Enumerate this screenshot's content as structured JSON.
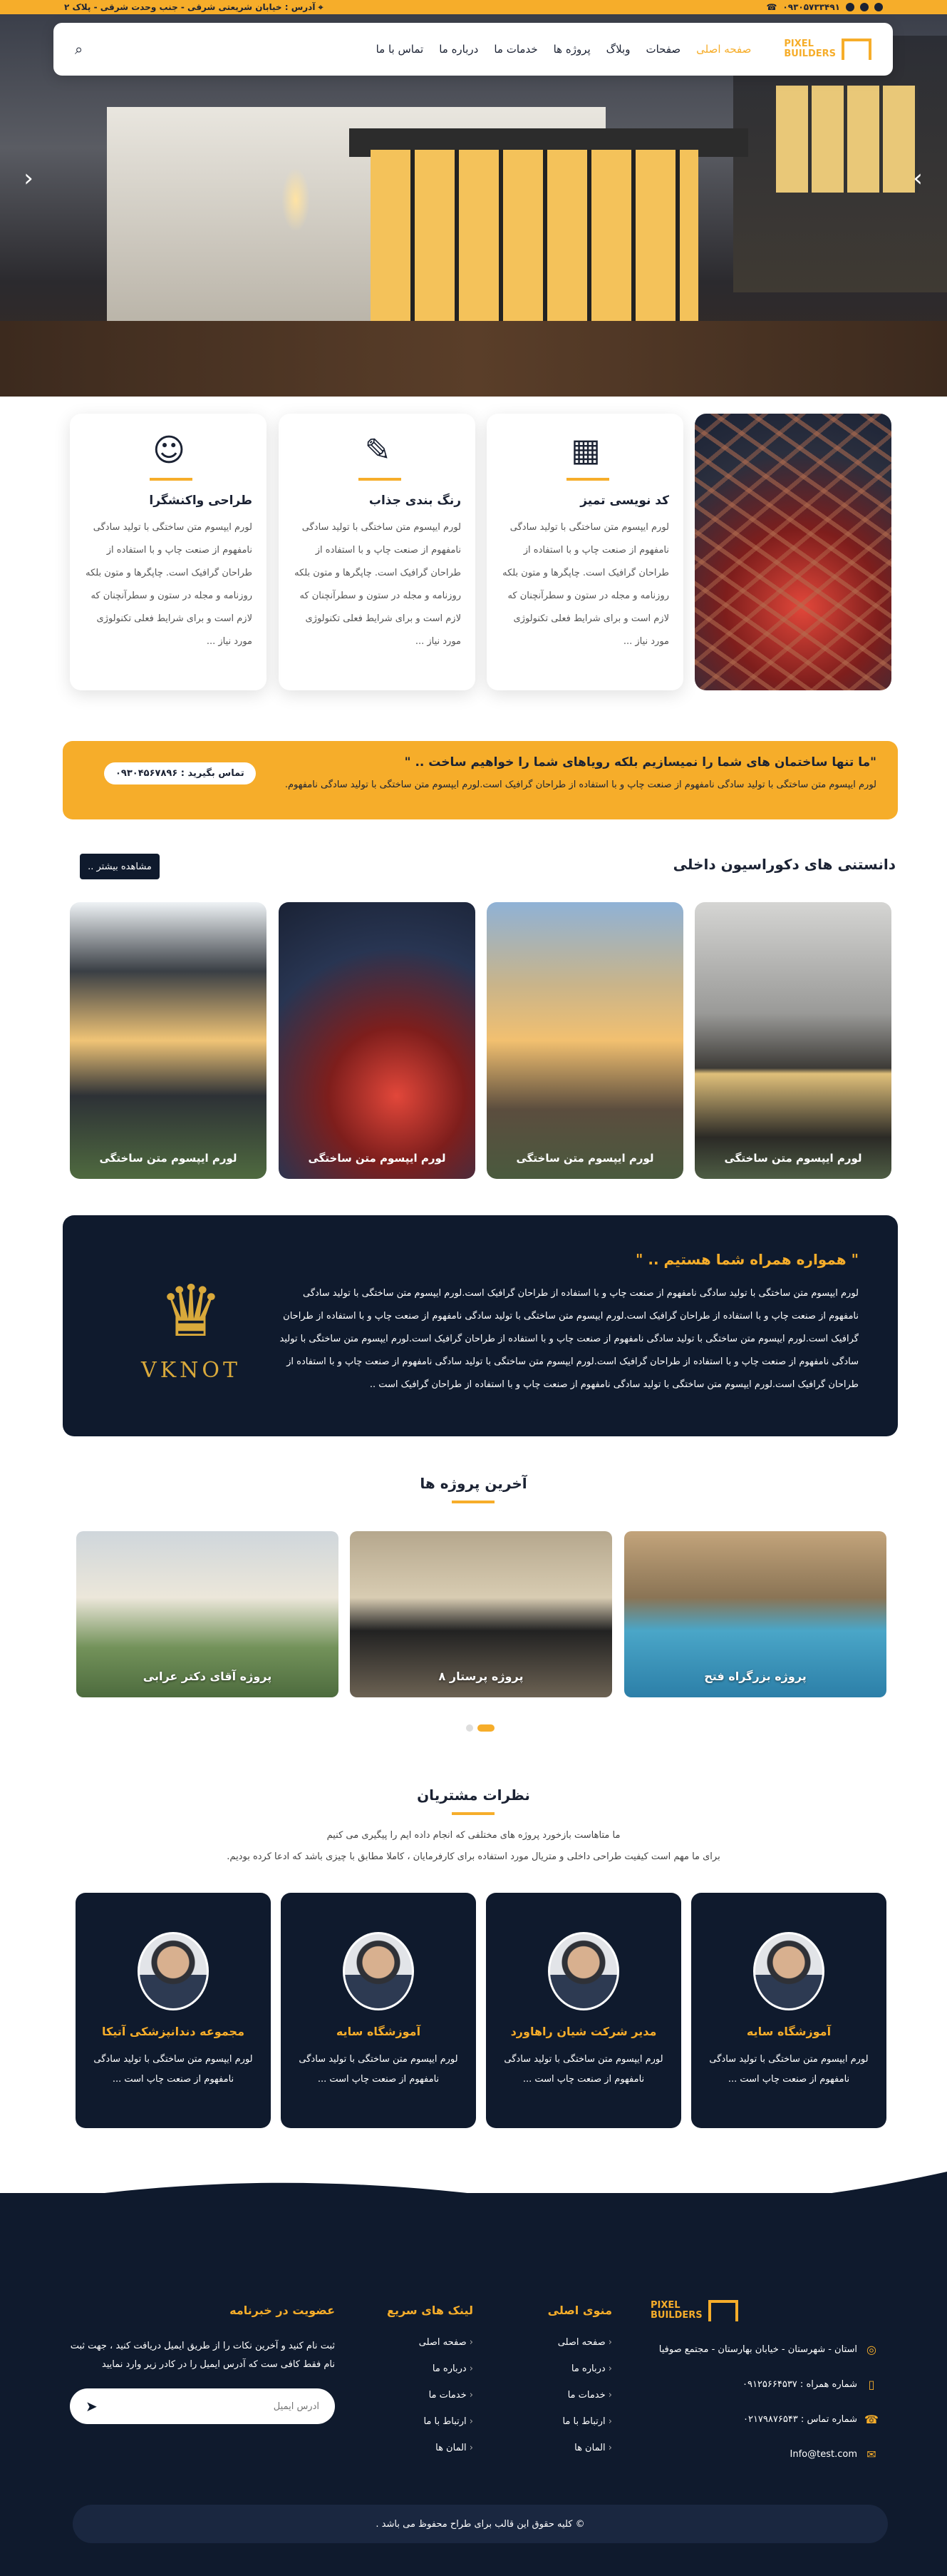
{
  "topbar": {
    "phone": "۰۹۳۰۵۷۳۳۴۹۱",
    "address": "آدرس : خیابان شریعتی شرقی - جنب وحدت شرقی - پلاک ۲"
  },
  "nav": {
    "logo_line1": "PIXEL",
    "logo_line2": "BUILDERS",
    "items": [
      "صفحه اصلی",
      "صفحات",
      "وبلاگ",
      "پروژه ها",
      "خدمات ما",
      "درباره ما",
      "تماس با ما"
    ]
  },
  "features": [
    {
      "title": "کد نویسی تمیز",
      "text": "لورم ایپسوم متن ساختگی با تولید سادگی نامفهوم از صنعت چاپ و با استفاده از طراحان گرافیک است. چاپگرها و متون بلکه روزنامه و مجله در ستون و سطرآنچنان که لازم است و برای شرایط فعلی تکنولوژی مورد نیاز ..."
    },
    {
      "title": "رنگ بندی جذاب",
      "text": "لورم ایپسوم متن ساختگی با تولید سادگی نامفهوم از صنعت چاپ و با استفاده از طراحان گرافیک است. چاپگرها و متون بلکه روزنامه و مجله در ستون و سطرآنچنان که لازم است و برای شرایط فعلی تکنولوژی مورد نیاز ..."
    },
    {
      "title": "طراحی واکنشگرا",
      "text": "لورم ایپسوم متن ساختگی با تولید سادگی نامفهوم از صنعت چاپ و با استفاده از طراحان گرافیک است. چاپگرها و متون بلکه روزنامه و مجله در ستون و سطرآنچنان که لازم است و برای شرایط فعلی تکنولوژی مورد نیاز ..."
    }
  ],
  "cta": {
    "title": "\"ما تنها ساختمان های شما را نمیسازیم بلکه رویاهای شما را خواهیم ساخت .. \"",
    "text": "لورم ایپسوم متن ساختگی با تولید سادگی نامفهوم از صنعت چاپ و با استفاده از طراحان گرافیک است.لورم ایپسوم متن ساختگی با تولید سادگی نامفهوم.",
    "button": "تماس بگیرید : ۰۹۳۰۴۵۶۷۸۹۶"
  },
  "knowledge": {
    "title": "دانستنی های دکوراسیون داخلی",
    "more": "مشاهده بیشتر ..",
    "cards": [
      "لورم ایپسوم متن ساختگی",
      "لورم ایپسوم متن ساختگی",
      "لورم ایپسوم متن ساختگی",
      "لورم ایپسوم متن ساختگی"
    ]
  },
  "about": {
    "title": "\" همواره همراه شما هستیم .. \"",
    "text": "لورم ایپسوم متن ساختگی با تولید سادگی نامفهوم از صنعت چاپ و با استفاده از طراحان گرافیک است.لورم ایپسوم متن ساختگی با تولید سادگی نامفهوم از صنعت چاپ و با استفاده از طراحان گرافیک است.لورم ایپسوم متن ساختگی با تولید سادگی نامفهوم از صنعت چاپ و با استفاده از طراحان گرافیک است.لورم ایپسوم متن ساختگی با تولید سادگی نامفهوم از صنعت چاپ و با استفاده از طراحان گرافیک است.لورم ایپسوم متن ساختگی با تولید سادگی نامفهوم از صنعت چاپ و با استفاده از طراحان گرافیک است.لورم ایپسوم متن ساختگی با تولید سادگی نامفهوم از صنعت چاپ و با استفاده از طراحان گرافیک است.لورم ایپسوم متن ساختگی با تولید سادگی نامفهوم از صنعت چاپ و با استفاده از طراحان گرافیک است ..",
    "brand": "VKNOT"
  },
  "projects": {
    "title": "آخرین پروژه ها",
    "items": [
      "پروژه بزرگراه فتح",
      "پروژه پرستار ۸",
      "پروژه آقای دکتر عرابی"
    ]
  },
  "testimonials": {
    "title": "نظرات مشتریان",
    "subtitle1": "ما متاهاست بازخورد پروژه های مختلفی که انجام داده ایم را پیگیری می کنیم",
    "subtitle2": "برای ما مهم است کیفیت طراحی داخلی و متریال مورد استفاده برای کارفرمایان ، کاملا مطابق با چیزی باشد که ادعا کرده بودیم.",
    "cards": [
      {
        "name": "آموزشگاه سایه",
        "text": "لورم ایپسوم متن ساختگی با تولید سادگی نامفهوم از صنعت چاپ است ..."
      },
      {
        "name": "مدیر شرکت شیان راهاورد",
        "text": "لورم ایپسوم متن ساختگی با تولید سادگی نامفهوم از صنعت چاپ است ..."
      },
      {
        "name": "آموزشگاه سایه",
        "text": "لورم ایپسوم متن ساختگی با تولید سادگی نامفهوم از صنعت چاپ است ..."
      },
      {
        "name": "مجموعه دندانپزشکی آتیکا",
        "text": "لورم ایپسوم متن ساختگی با تولید سادگی نامفهوم از صنعت چاپ است ..."
      }
    ]
  },
  "footer": {
    "address": "استان - شهرستان - خیابان بهارستان - مجتمع صوفیا",
    "mobile": "شماره همراه : ۰۹۱۲۵۶۶۴۵۳۷",
    "phone": "شماره تماس : ۰۲۱۷۹۸۷۶۵۴۳",
    "email": "Info@test.com",
    "main_menu_title": "منوی اصلی",
    "main_menu": [
      "صفحه اصلی",
      "درباره ما",
      "خدمات ما",
      "ارتباط با ما",
      "المان ها"
    ],
    "quick_title": "لینک های سریع",
    "quick_links": [
      "صفحه اصلی",
      "درباره ما",
      "خدمات ما",
      "ارتباط با ما",
      "المان ها"
    ],
    "newsletter_title": "عضویت در خبرنامه",
    "newsletter_text": "ثبت نام کنید و آخرین نکات را از طریق ایمیل دریافت کنید ، جهت ثبت نام فقط کافی ست که آدرس ایمیل را در کادر زیر وارد نمایید",
    "email_placeholder": "آدرس ایمیل",
    "copyright": "© کلیه حقوق این قالب برای طراح محفوظ می باشد ."
  },
  "colors": {
    "accent": "#f6ad2a",
    "dark": "#0f1a2d"
  }
}
